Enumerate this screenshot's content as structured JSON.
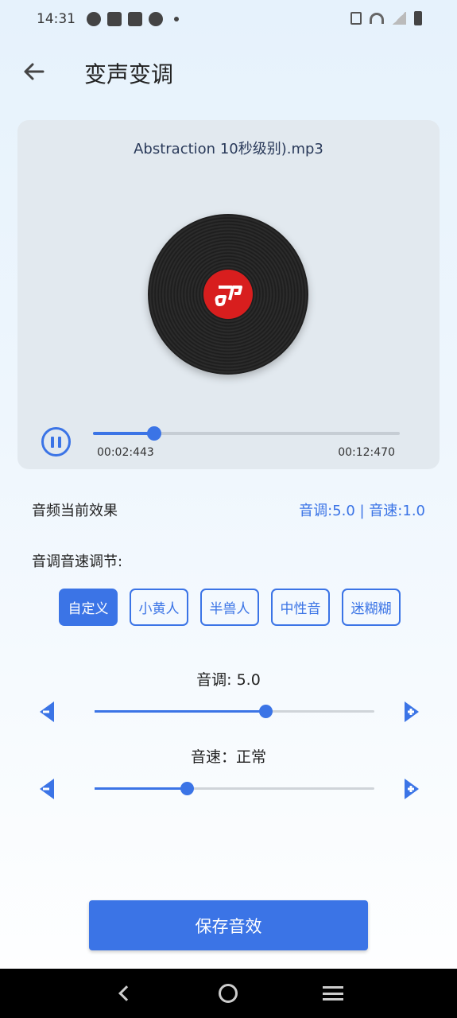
{
  "status_bar": {
    "time": "14:31"
  },
  "header": {
    "title": "变声变调",
    "back_icon": "arrow-left-icon"
  },
  "player": {
    "file_name": "Abstraction 10秒级别).mp3",
    "current_time": "00:02:443",
    "total_time": "00:12:470",
    "progress": 0.2,
    "state": "playing"
  },
  "effect": {
    "label": "音频当前效果",
    "value": "音调:5.0 | 音速:1.0"
  },
  "adjust": {
    "title": "音调音速调节:",
    "presets": [
      {
        "label": "自定义",
        "active": true
      },
      {
        "label": "小黄人",
        "active": false
      },
      {
        "label": "半兽人",
        "active": false
      },
      {
        "label": "中性音",
        "active": false
      },
      {
        "label": "迷糊糊",
        "active": false
      }
    ]
  },
  "pitch": {
    "label": "音调: 5.0",
    "level": 0.61
  },
  "speed": {
    "label": "音速：正常",
    "level": 0.33
  },
  "save_label": "保存音效",
  "colors": {
    "accent": "#3b74e6",
    "disc_label": "#d81e1e"
  }
}
